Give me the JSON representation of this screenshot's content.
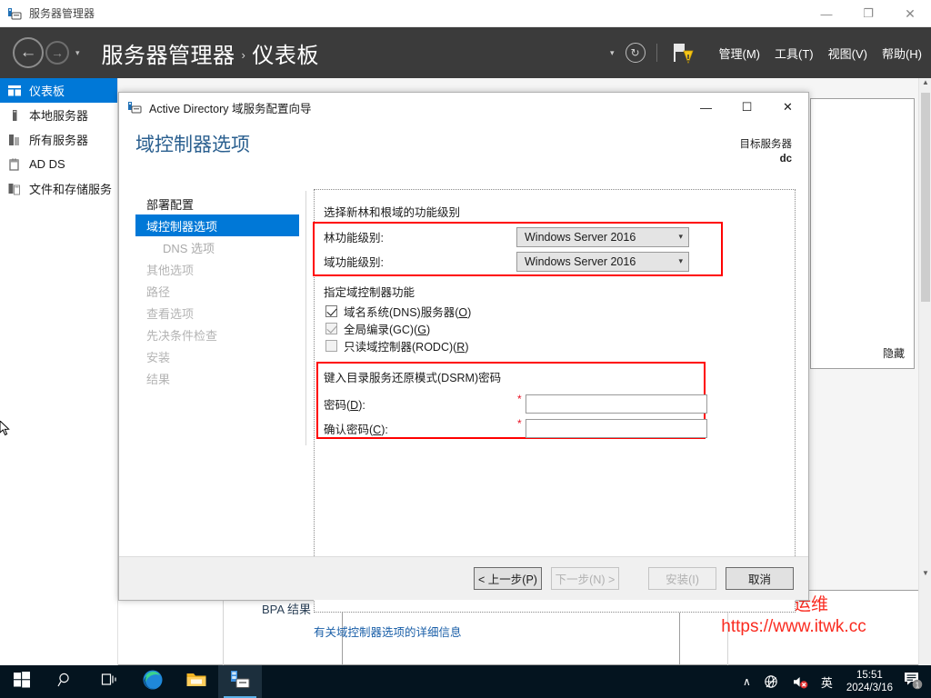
{
  "app": {
    "window_title": "服务器管理器",
    "breadcrumb_root": "服务器管理器",
    "breadcrumb_sep": "›",
    "breadcrumb_leaf": "仪表板",
    "window_controls": {
      "minimize": "—",
      "restore": "❐",
      "close": "✕"
    },
    "header_menu": [
      {
        "label": "管理(M)"
      },
      {
        "label": "工具(T)"
      },
      {
        "label": "视图(V)"
      },
      {
        "label": "帮助(H)"
      }
    ],
    "refresh_icon": "↻",
    "caret_icon": "▾"
  },
  "sidebar": {
    "items": [
      {
        "label": "仪表板",
        "icon": "dashboard-icon",
        "active": true
      },
      {
        "label": "本地服务器",
        "icon": "server-icon",
        "active": false
      },
      {
        "label": "所有服务器",
        "icon": "servers-icon",
        "active": false
      },
      {
        "label": "AD DS",
        "icon": "adds-icon",
        "active": false
      },
      {
        "label": "文件和存储服务",
        "icon": "storage-icon",
        "active": false
      }
    ]
  },
  "background": {
    "bpa_label": "BPA 结果",
    "hide_label": "隐藏",
    "watermark_line1": "极客运维",
    "watermark_line2": "https://www.itwk.cc",
    "watermark_color": "#fa2b20"
  },
  "dialog": {
    "title": "Active Directory 域服务配置向导",
    "title_icon": "wizard-icon",
    "controls": {
      "minimize": "—",
      "maximize": "☐",
      "close": "✕"
    },
    "heading": "域控制器选项",
    "target_label": "目标服务器",
    "target_value": "dc",
    "steps": [
      {
        "label": "部署配置",
        "state": "done"
      },
      {
        "label": "域控制器选项",
        "state": "active"
      },
      {
        "label": "DNS 选项",
        "state": "sub"
      },
      {
        "label": "其他选项",
        "state": "disabled"
      },
      {
        "label": "路径",
        "state": "disabled"
      },
      {
        "label": "查看选项",
        "state": "disabled"
      },
      {
        "label": "先决条件检查",
        "state": "disabled"
      },
      {
        "label": "安装",
        "state": "disabled"
      },
      {
        "label": "结果",
        "state": "disabled"
      }
    ],
    "section_levels_title": "选择新林和根域的功能级别",
    "forest_level_label": "林功能级别:",
    "forest_level_value": "Windows Server 2016",
    "domain_level_label": "域功能级别:",
    "domain_level_value": "Windows Server 2016",
    "section_caps_title": "指定域控制器功能",
    "capabilities": [
      {
        "label_pre": "域名系统(DNS)服务器(",
        "accel": "O",
        "label_post": ")",
        "checked": true,
        "disabled": false
      },
      {
        "label_pre": "全局编录(GC)(",
        "accel": "G",
        "label_post": ")",
        "checked": true,
        "disabled": true
      },
      {
        "label_pre": "只读域控制器(RODC)(",
        "accel": "R",
        "label_post": ")",
        "checked": false,
        "disabled": false
      }
    ],
    "section_dsrm_title": "键入目录服务还原模式(DSRM)密码",
    "password_label_pre": "密码(",
    "password_accel": "D",
    "password_label_post": "):",
    "password_value": "",
    "confirm_label_pre": "确认密码(",
    "confirm_accel": "C",
    "confirm_label_post": "):",
    "confirm_value": "",
    "required_mark": "*",
    "more_info_link": "有关域控制器选项的详细信息",
    "buttons": {
      "prev": "< 上一步(P)",
      "next": "下一步(N) >",
      "install": "安装(I)",
      "cancel": "取消"
    },
    "highlight_color": "#ff0000"
  },
  "taskbar": {
    "start_icon": "windows-start-icon",
    "search_icon": "search-icon",
    "taskview_icon": "task-view-icon",
    "edge_icon": "edge-browser-icon",
    "explorer_icon": "file-explorer-icon",
    "servermanager_icon": "server-manager-icon",
    "tray": {
      "chevron": "∧",
      "network_icon": "network-offline-icon",
      "volume_icon": "volume-muted-icon",
      "ime_label": "英",
      "time": "15:51",
      "date": "2024/3/16",
      "notification_count": "1"
    }
  }
}
